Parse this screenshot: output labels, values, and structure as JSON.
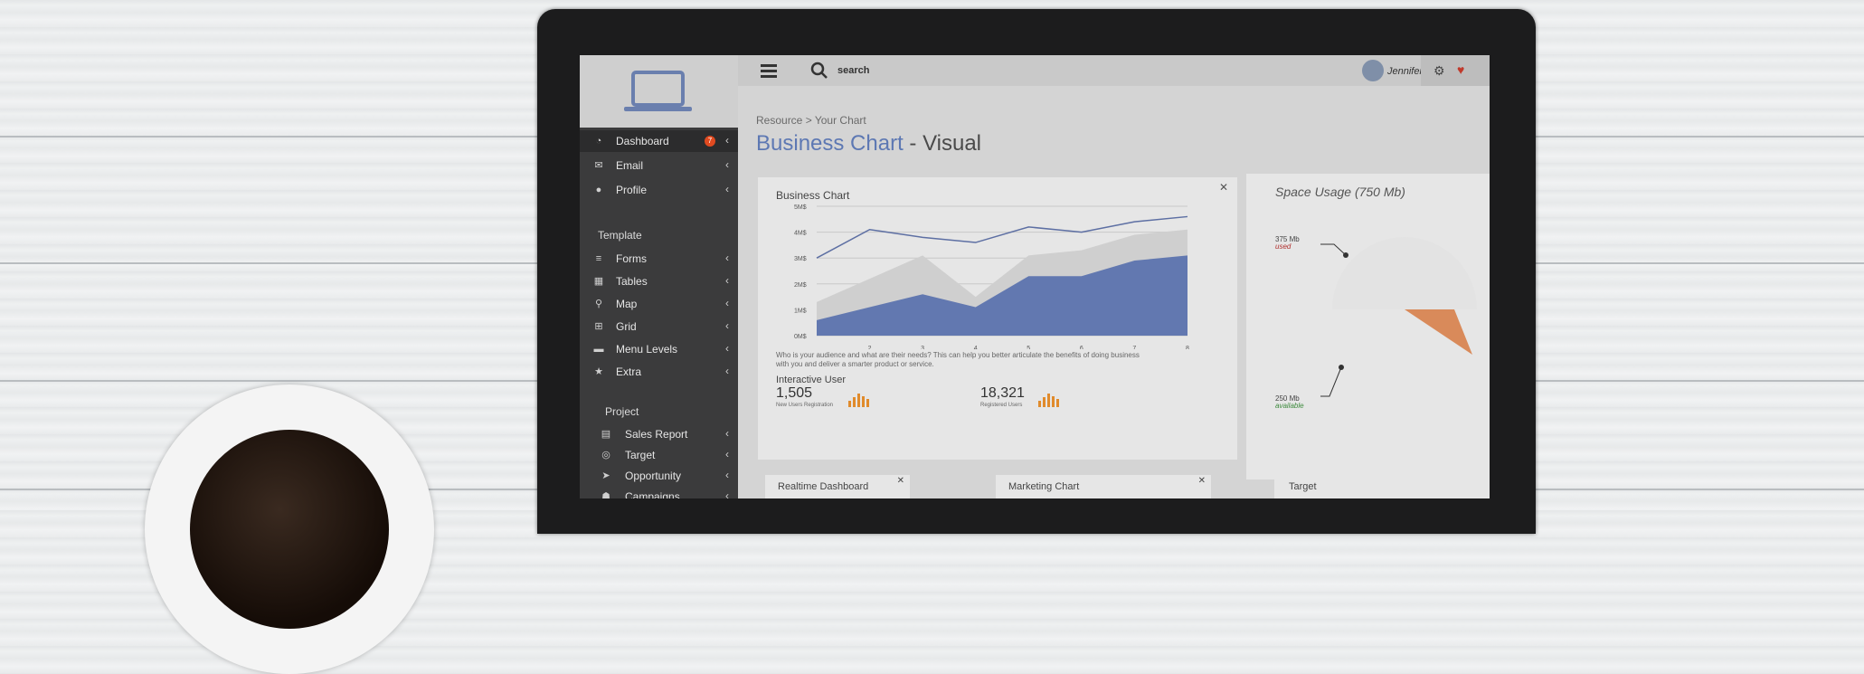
{
  "topbar": {
    "search_placeholder": "search",
    "user_name": "Jennifer ▾"
  },
  "sidebar": {
    "items": [
      {
        "label": "Dashboard",
        "badge": "7",
        "icon": "dashboard-icon"
      },
      {
        "label": "Email",
        "icon": "envelope-icon"
      },
      {
        "label": "Profile",
        "icon": "user-icon"
      }
    ],
    "template_title": "Template",
    "template_items": [
      {
        "label": "Forms",
        "icon": "list-icon"
      },
      {
        "label": "Tables",
        "icon": "table-icon"
      },
      {
        "label": "Map",
        "icon": "map-pin-icon"
      },
      {
        "label": "Grid",
        "icon": "grid-icon"
      },
      {
        "label": "Menu Levels",
        "icon": "folder-icon"
      },
      {
        "label": "Extra",
        "icon": "star-icon"
      }
    ],
    "project_title": "Project",
    "project_items": [
      {
        "label": "Sales Report",
        "icon": "report-icon"
      },
      {
        "label": "Target",
        "icon": "target-icon"
      },
      {
        "label": "Opportunity",
        "icon": "send-icon"
      },
      {
        "label": "Campaigns",
        "icon": "campaign-icon"
      }
    ]
  },
  "page": {
    "breadcrumb": "Resource > Your Chart",
    "title_main": "Business Chart",
    "title_suffix": " - Visual"
  },
  "chart_card": {
    "title": "Business Chart",
    "description_line1": "Who is your audience and what are their needs? This can help you better articulate the benefits of doing business",
    "description_line2": "with you and deliver a smarter product or service.",
    "interactive_title": "Interactive User",
    "stat1_value": "1,505",
    "stat1_label": "New Users Registration",
    "stat2_value": "18,321",
    "stat2_label": "Registered Users"
  },
  "space_card": {
    "title": "Space Usage (750 Mb)",
    "used_value": "375 Mb",
    "used_label": "used",
    "available_value": "250 Mb",
    "available_label": "available"
  },
  "bottom_cards": [
    "Realtime Dashboard",
    "Marketing Chart",
    "Target"
  ],
  "colors": {
    "accent": "#5d78b3",
    "sidebar": "#3b3b3c",
    "orange": "#e08b2c",
    "used": "#b0302e",
    "available": "#3c8a3c"
  },
  "chart_data": {
    "type": "area",
    "title": "Business Chart",
    "x": [
      1,
      2,
      3,
      4,
      5,
      6,
      7,
      8
    ],
    "x_tick_labels": [
      "2",
      "3",
      "4",
      "5",
      "6",
      "7",
      "8"
    ],
    "y_tick_labels": [
      "0M$",
      "1M$",
      "2M$",
      "3M$",
      "4M$",
      "5M$"
    ],
    "ylim": [
      0,
      5
    ],
    "series": [
      {
        "values": [
          3.0,
          4.1,
          3.8,
          3.6,
          4.2,
          4.0,
          4.4,
          4.6
        ],
        "style": "line",
        "color": "#5d6fa3"
      },
      {
        "values": [
          1.3,
          2.2,
          3.1,
          1.5,
          3.1,
          3.3,
          3.9,
          4.1
        ],
        "style": "area",
        "color": "#cfcfcf"
      },
      {
        "values": [
          0.6,
          1.1,
          1.6,
          1.1,
          2.3,
          2.3,
          2.9,
          3.1
        ],
        "style": "area",
        "color": "#6278b0"
      }
    ]
  }
}
